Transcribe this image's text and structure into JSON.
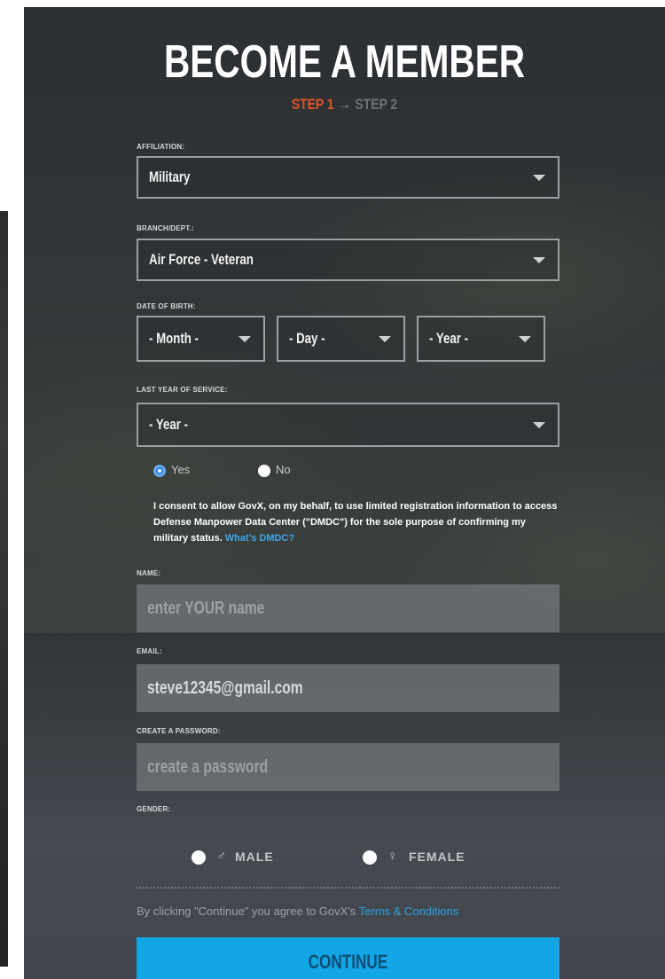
{
  "header": {
    "title": "BECOME A MEMBER",
    "step1": "STEP 1",
    "arrow": "→",
    "step2": "STEP 2"
  },
  "form": {
    "affiliation": {
      "label": "AFFILIATION:",
      "value": "Military"
    },
    "branch": {
      "label": "BRANCH/DEPT.:",
      "value": "Air Force - Veteran"
    },
    "dob": {
      "label": "DATE OF BIRTH:",
      "month": "- Month -",
      "day": "- Day -",
      "year": "- Year -"
    },
    "last_year": {
      "label": "LAST YEAR OF SERVICE:",
      "value": "- Year -"
    },
    "consent_choice": {
      "yes": "Yes",
      "no": "No",
      "selected": "Yes"
    },
    "consent_text": "I consent to allow GovX, on my behalf, to use limited registration information to access Defense Manpower Data Center (\"DMDC\") for the sole purpose of confirming my military status.",
    "consent_link": "What's DMDC?",
    "name": {
      "label": "NAME:",
      "placeholder": "enter YOUR name",
      "value": ""
    },
    "email": {
      "label": "EMAIL:",
      "value": "steve12345@gmail.com"
    },
    "password": {
      "label": "CREATE A PASSWORD:",
      "placeholder": "create a password",
      "value": ""
    },
    "gender": {
      "label": "GENDER:",
      "male": "MALE",
      "female": "FEMALE",
      "male_icon": "male-icon",
      "female_icon": "female-icon"
    },
    "terms_prefix": "By clicking \"Continue\" you agree to GovX's",
    "terms_link": "Terms & Conditions",
    "continue_label": "CONTINUE"
  },
  "colors": {
    "accent_step": "#e0542a",
    "button": "#12a6e6",
    "link": "#2aa0e0"
  }
}
